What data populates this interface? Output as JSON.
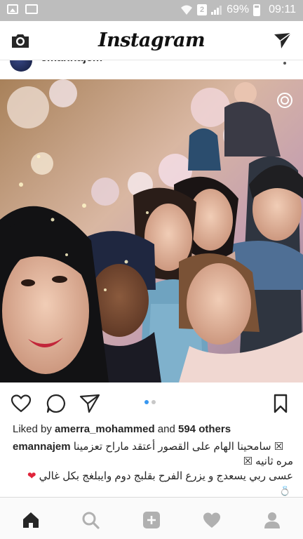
{
  "status_bar": {
    "battery": "69%",
    "time": "09:11",
    "sim_slot": "2",
    "icons": [
      "image-notification-icon",
      "gallery-notification-icon",
      "wifi-icon",
      "sim-icon",
      "signal-icon",
      "battery-icon"
    ]
  },
  "app_bar": {
    "title": "Instagram",
    "icons": [
      "camera-icon",
      "direct-message-icon"
    ]
  },
  "previous_post": {
    "username": "emannajem"
  },
  "post": {
    "carousel": {
      "count": 2,
      "active_index": 0
    },
    "likes": {
      "prefix": "Liked by",
      "user": "amerra_mohammed",
      "middle": "and",
      "others": "594 others"
    },
    "caption": {
      "username": "emannajem",
      "line1": "سامحينا الهام على القصور أعتقد ماراح تعزمينا",
      "line2": "مره ثانيه",
      "line3": "عسى ربي يسعدج و يزرع الفرح بقلبج دوم وايبلغج بكل غالي",
      "emoji_heart": "❤",
      "emoji_ring": "💍"
    },
    "action_icons": [
      "heart-icon",
      "comment-icon",
      "share-icon",
      "bookmark-icon"
    ]
  },
  "bottom_nav": [
    "home-icon",
    "search-icon",
    "add-icon",
    "activity-heart-icon",
    "profile-icon"
  ],
  "colors": {
    "status_bar_bg": "#bdbdbd",
    "carousel_active": "#3897f0",
    "text": "#262626"
  }
}
